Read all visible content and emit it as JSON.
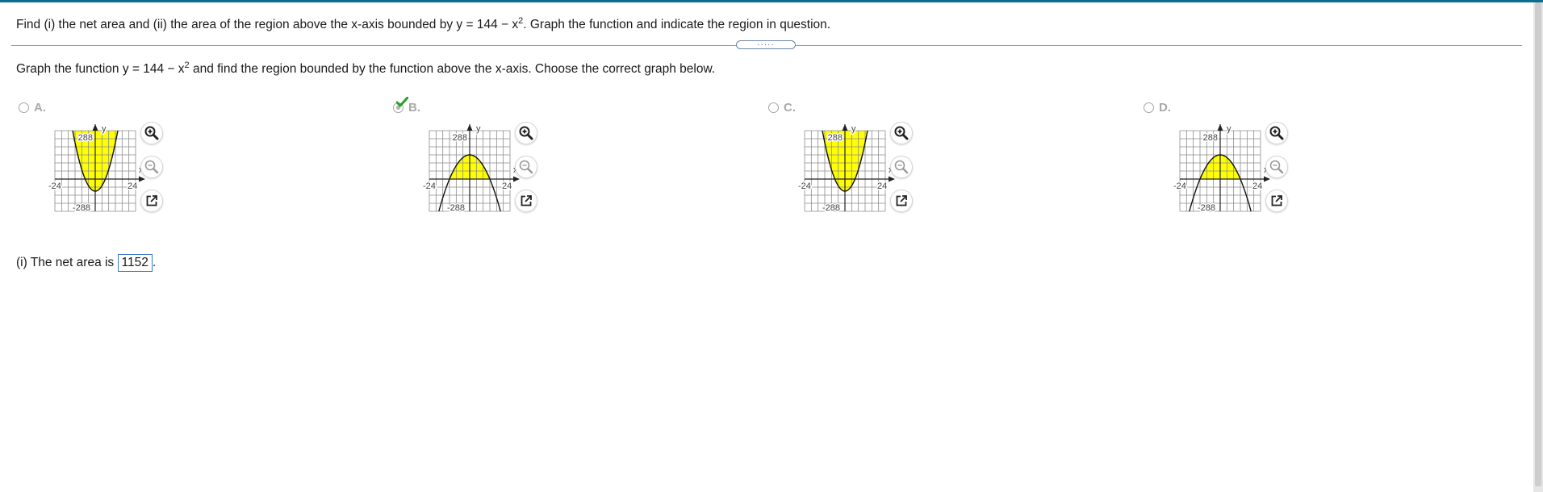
{
  "question": {
    "prefix": "Find (i) the net area and (ii) the area of the region above the x-axis bounded by y = 144 − x",
    "exponent": "2",
    "suffix": ". Graph the function and indicate the region in question."
  },
  "expander_dots": "·····",
  "instruction": {
    "prefix": "Graph the function y = 144 − x",
    "exponent": "2",
    "suffix": " and find the region bounded by the function above the x-axis. Choose the correct graph below."
  },
  "choices": [
    {
      "label": "A.",
      "selected": false,
      "shape": "upward-parabola-shaded-above"
    },
    {
      "label": "B.",
      "selected": true,
      "shape": "downward-parabola-shaded-above-axis"
    },
    {
      "label": "C.",
      "selected": false,
      "shape": "upward-parabola-shaded-above"
    },
    {
      "label": "D.",
      "selected": false,
      "shape": "downward-parabola-shaded-above-axis"
    }
  ],
  "graph_labels": {
    "y": "y",
    "x": "x",
    "ymax": "288",
    "ymin": "-288",
    "xmin": "-24",
    "xmax": "24"
  },
  "net_area": {
    "label": "(i) The net area is",
    "value": "1152",
    "suffix": "."
  },
  "colors": {
    "shade": "#ffff00",
    "accent": "#0a6e8c",
    "check": "#2aa12a"
  },
  "icons": [
    "zoom-in-icon",
    "zoom-out-icon",
    "popout-icon",
    "checkmark-icon"
  ]
}
